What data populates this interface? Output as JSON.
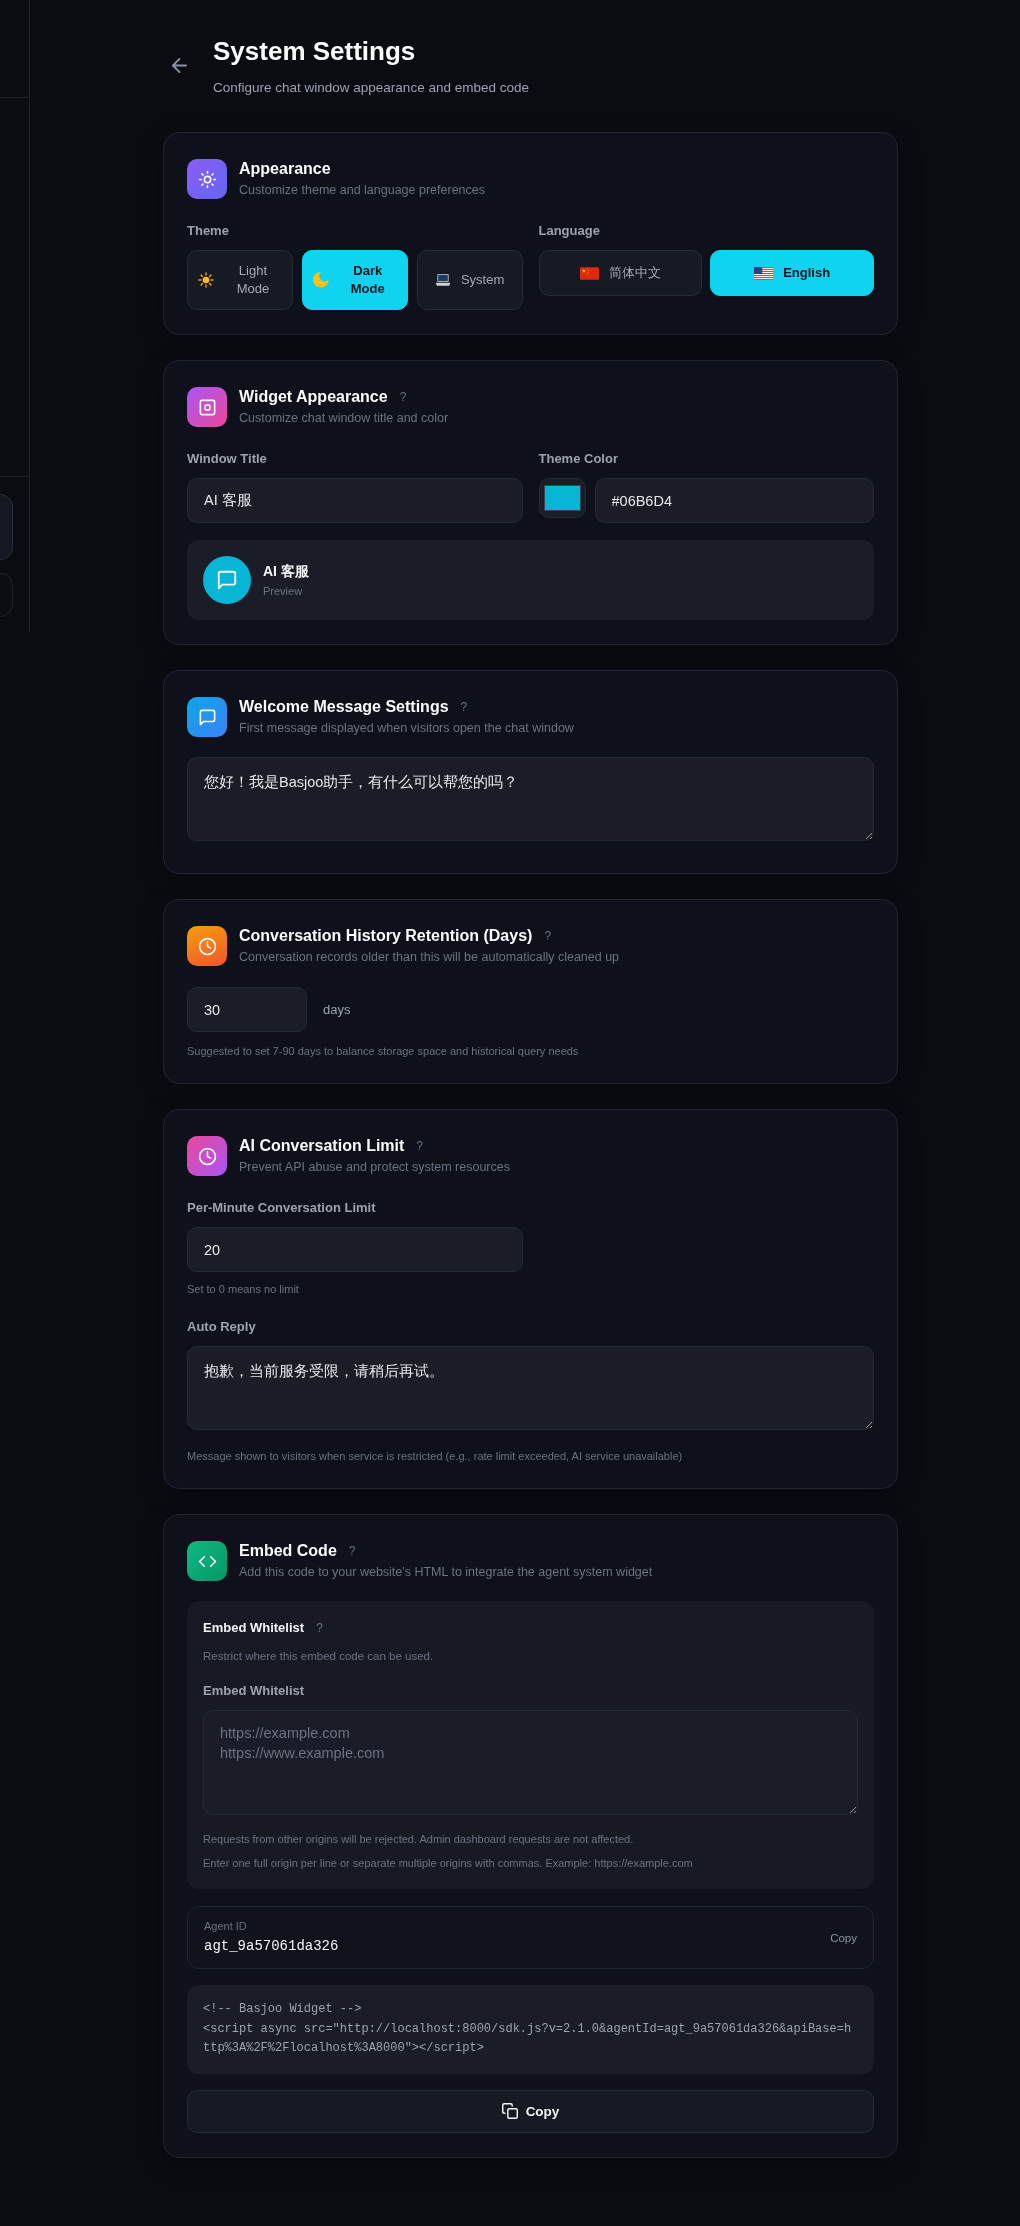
{
  "sidebar": {
    "items": [
      {
        "selected": true
      },
      {
        "selected": false
      }
    ]
  },
  "header": {
    "title": "System Settings",
    "subtitle": "Configure chat window appearance and embed code"
  },
  "appearance": {
    "title": "Appearance",
    "subtitle": "Customize theme and language preferences",
    "theme": {
      "label": "Theme",
      "options": [
        {
          "kind": "light",
          "label": "Light Mode",
          "selected": false
        },
        {
          "kind": "dark",
          "label": "Dark Mode",
          "selected": true
        },
        {
          "kind": "system",
          "label": "System",
          "selected": false
        }
      ]
    },
    "language": {
      "label": "Language",
      "options": [
        {
          "kind": "chinese",
          "label": "简体中文",
          "selected": false
        },
        {
          "kind": "english",
          "label": "English",
          "selected": true
        }
      ]
    }
  },
  "widget_appearance": {
    "title": "Widget Appearance",
    "help": "?",
    "subtitle": "Customize chat window title and color",
    "window_title": {
      "label": "Window Title",
      "value": "AI 客服"
    },
    "theme_color": {
      "label": "Theme Color",
      "value": "#06B6D4"
    },
    "preview": {
      "title": "AI 客服",
      "caption": "Preview"
    }
  },
  "welcome_message": {
    "title": "Welcome Message Settings",
    "help": "?",
    "subtitle": "First message displayed when visitors open the chat window",
    "value": "您好！我是Basjoo助手，有什么可以帮您的吗？"
  },
  "history_retention": {
    "title": "Conversation History Retention (Days)",
    "help": "?",
    "subtitle": "Conversation records older than this will be automatically cleaned up",
    "value": "30",
    "unit": "days",
    "hint": "Suggested to set 7-90 days to balance storage space and historical query needs"
  },
  "conversation_limit": {
    "title": "AI Conversation Limit",
    "help": "?",
    "subtitle": "Prevent API abuse and protect system resources",
    "per_minute": {
      "label": "Per-Minute Conversation Limit",
      "value": "20",
      "hint": "Set to 0 means no limit"
    },
    "auto_reply": {
      "label": "Auto Reply",
      "value": "抱歉，当前服务受限，请稍后再试。",
      "hint": "Message shown to visitors when service is restricted (e.g., rate limit exceeded, AI service unavailable)"
    }
  },
  "embed_code": {
    "title": "Embed Code",
    "help": "?",
    "subtitle": "Add this code to your website's HTML to integrate the agent system widget",
    "whitelist": {
      "title": "Embed Whitelist",
      "help": "?",
      "description": "Restrict where this embed code can be used.",
      "label": "Embed Whitelist",
      "placeholder": "https://example.com\nhttps://www.example.com",
      "hints": [
        "Requests from other origins will be rejected. Admin dashboard requests are not affected.",
        "Enter one full origin per line or separate multiple origins with commas. Example: https://example.com"
      ]
    },
    "agent_id": {
      "label": "Agent ID",
      "value": "agt_9a57061da326",
      "copy": "Copy"
    },
    "code": "<!-- Basjoo Widget -->\n<script async src=\"http://localhost:8000/sdk.js?v=2.1.0&agentId=agt_9a57061da326&apiBase=http%3A%2F%2Flocalhost%3A8000\"></script>",
    "copy_button": "Copy"
  }
}
